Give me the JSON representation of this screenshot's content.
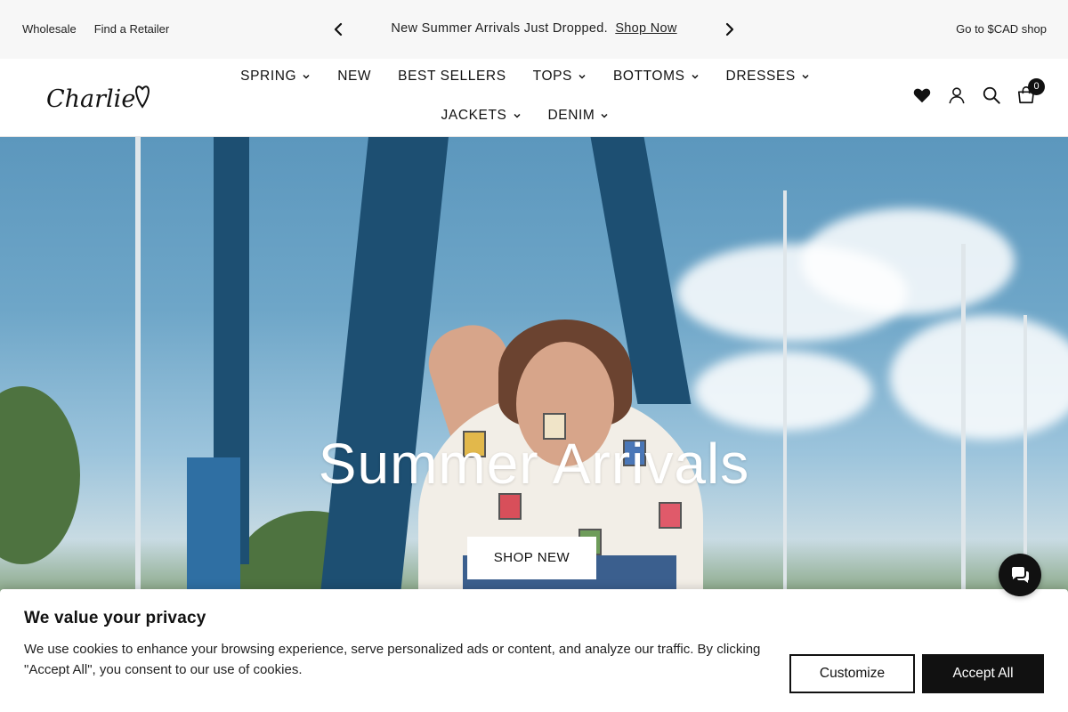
{
  "topbar": {
    "wholesale": "Wholesale",
    "find_retailer": "Find a Retailer",
    "announcement": "New Summer Arrivals Just Dropped.",
    "announcement_link": "Shop Now",
    "currency_link": "Go to $CAD shop"
  },
  "header": {
    "logo_text": "Charlie",
    "nav": [
      {
        "label": "SPRING",
        "has_dropdown": true
      },
      {
        "label": "NEW",
        "has_dropdown": false
      },
      {
        "label": "BEST SELLERS",
        "has_dropdown": false
      },
      {
        "label": "TOPS",
        "has_dropdown": true
      },
      {
        "label": "BOTTOMS",
        "has_dropdown": true
      },
      {
        "label": "DRESSES",
        "has_dropdown": true
      },
      {
        "label": "JACKETS",
        "has_dropdown": true
      },
      {
        "label": "DENIM",
        "has_dropdown": true
      }
    ],
    "icons": [
      "heart-icon",
      "account-icon",
      "search-icon",
      "cart-icon"
    ],
    "cart_count": "0"
  },
  "hero": {
    "title": "Summer Arrivals",
    "button_label": "SHOP NEW"
  },
  "cookie": {
    "title": "We value your privacy",
    "text": "We use cookies to enhance your browsing experience, serve personalized ads or content, and analyze our traffic. By clicking \"Accept All\", you consent to our use of cookies.",
    "customize_label": "Customize",
    "accept_label": "Accept All"
  },
  "colors": {
    "text": "#111111",
    "topbar_bg": "#f7f7f7",
    "button_dark": "#111111"
  }
}
